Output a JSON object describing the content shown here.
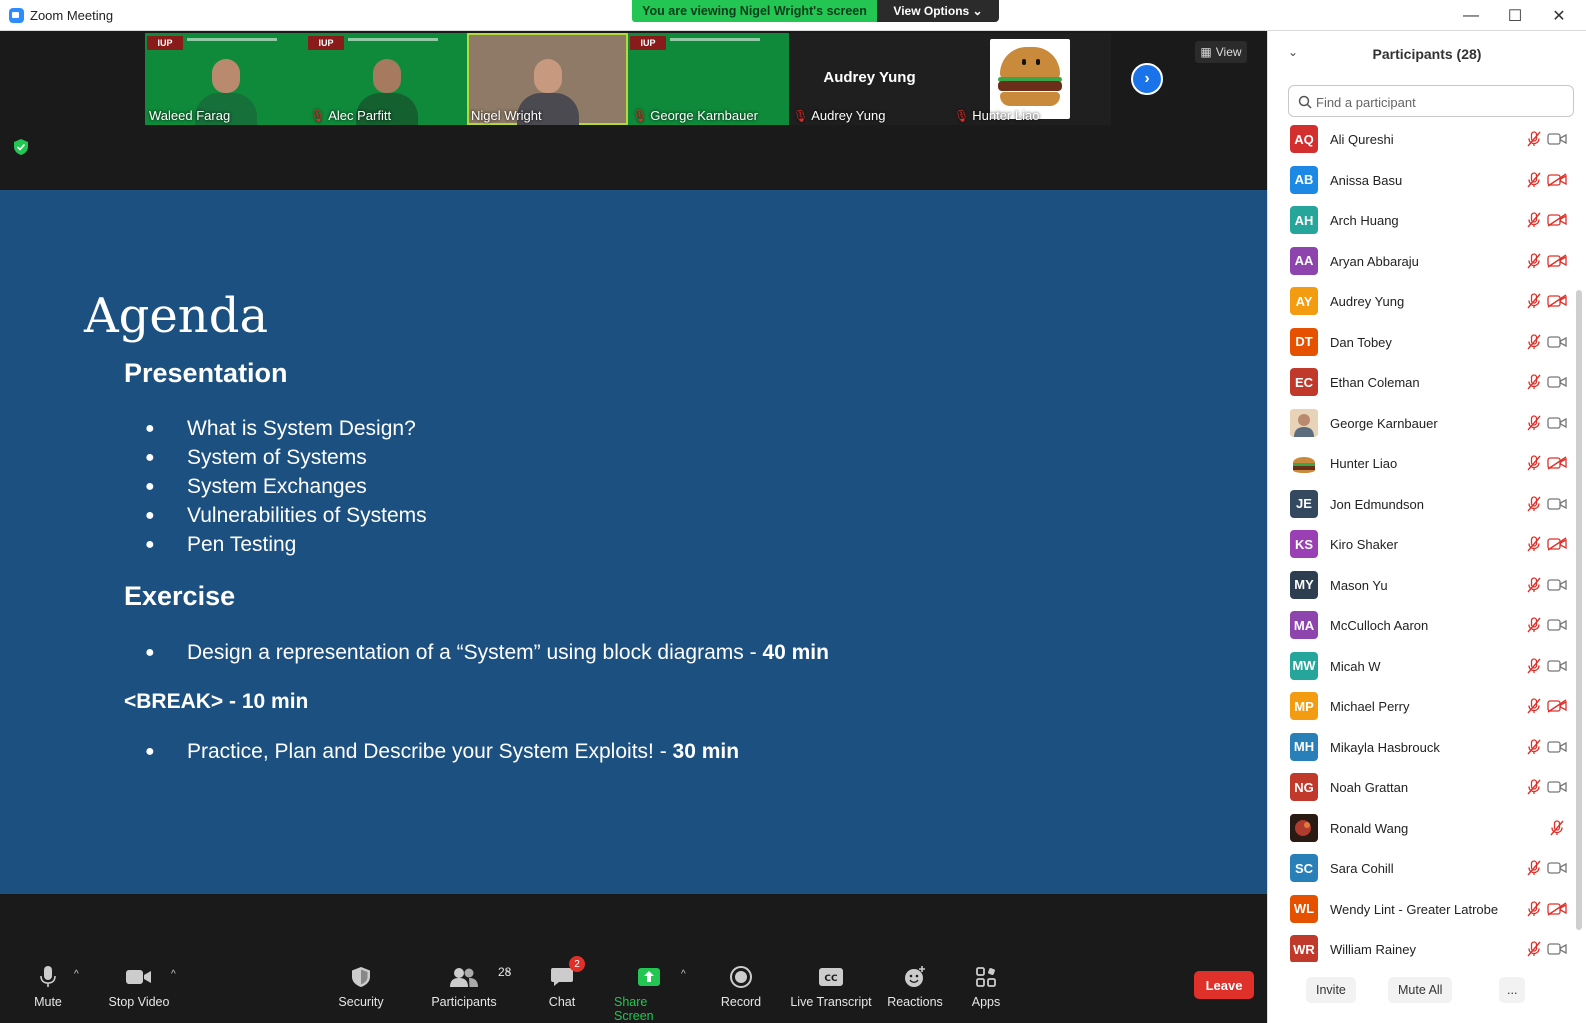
{
  "window": {
    "title": "Zoom Meeting",
    "minimize": "—",
    "maximize": "☐",
    "close": "✕"
  },
  "banner": {
    "viewing": "You are viewing Nigel Wright's screen",
    "view_options": "View Options ⌄"
  },
  "thumbnails": [
    {
      "name": "Waleed Farag",
      "muted": false,
      "badge": "IUP"
    },
    {
      "name": "Alec Parfitt",
      "muted": true,
      "badge": "IUP"
    },
    {
      "name": "Nigel Wright",
      "muted": false,
      "talking": true
    },
    {
      "name": "George Karnbauer",
      "muted": true,
      "badge": "IUP"
    },
    {
      "name": "Audrey Yung",
      "display": "Audrey Yung",
      "muted": true
    },
    {
      "name": "Hunter Liao",
      "muted": true
    }
  ],
  "view_button": "View",
  "slide": {
    "title": "Agenda",
    "section1": "Presentation",
    "items1": [
      "What is System Design?",
      "System of Systems",
      "System Exchanges",
      "Vulnerabilities of Systems",
      "Pen Testing"
    ],
    "section2": "Exercise",
    "exercise_item": "Design a representation of a “System” using block diagrams - ",
    "exercise_time": "40 min",
    "break": "<BREAK> - 10 min",
    "practice_item": "Practice, Plan and Describe your System Exploits! - ",
    "practice_time": "30 min",
    "bullet": "●"
  },
  "toolbar": {
    "mute": "Mute",
    "stop_video": "Stop Video",
    "security": "Security",
    "participants": "Participants",
    "participants_count": "28",
    "chat": "Chat",
    "chat_badge": "2",
    "share_screen": "Share Screen",
    "record": "Record",
    "live_transcript": "Live Transcript",
    "reactions": "Reactions",
    "apps": "Apps",
    "leave": "Leave",
    "caret": "^"
  },
  "panel": {
    "title": "Participants (28)",
    "search_placeholder": "Find a participant",
    "collapse": "⌄",
    "invite": "Invite",
    "mute_all": "Mute All",
    "more": "..."
  },
  "participants": [
    {
      "initials": "AQ",
      "name": "Ali Qureshi",
      "color": "#d32f2f",
      "video_off": false
    },
    {
      "initials": "AB",
      "name": "Anissa Basu",
      "color": "#1e88e5",
      "video_off": true
    },
    {
      "initials": "AH",
      "name": "Arch Huang",
      "color": "#26a69a",
      "video_off": true
    },
    {
      "initials": "AA",
      "name": "Aryan Abbaraju",
      "color": "#8e44ad",
      "video_off": true
    },
    {
      "initials": "AY",
      "name": "Audrey Yung",
      "color": "#f39c12",
      "video_off": true
    },
    {
      "initials": "DT",
      "name": "Dan Tobey",
      "color": "#e65100",
      "video_off": false
    },
    {
      "initials": "EC",
      "name": "Ethan Coleman",
      "color": "#c0392b",
      "video_off": false
    },
    {
      "initials": "",
      "name": "George Karnbauer",
      "color": "#c9a27a",
      "photo": "face",
      "video_off": false
    },
    {
      "initials": "",
      "name": "Hunter Liao",
      "color": "#c98a3c",
      "photo": "burger",
      "video_off": true
    },
    {
      "initials": "JE",
      "name": "Jon Edmundson",
      "color": "#34495e",
      "video_off": false
    },
    {
      "initials": "KS",
      "name": "Kiro Shaker",
      "color": "#9b3fb5",
      "video_off": true
    },
    {
      "initials": "MY",
      "name": "Mason Yu",
      "color": "#2c3e50",
      "video_off": false
    },
    {
      "initials": "MA",
      "name": "McCulloch Aaron",
      "color": "#8e44ad",
      "video_off": false
    },
    {
      "initials": "MW",
      "name": "Micah W",
      "color": "#26a69a",
      "video_off": false
    },
    {
      "initials": "MP",
      "name": "Michael Perry",
      "color": "#f39c12",
      "video_off": true
    },
    {
      "initials": "MH",
      "name": "Mikayla Hasbrouck",
      "color": "#2980b9",
      "video_off": false
    },
    {
      "initials": "NG",
      "name": "Noah Grattan",
      "color": "#c0392b",
      "video_off": false
    },
    {
      "initials": "",
      "name": "Ronald Wang",
      "color": "#b03a2e",
      "photo": "dark",
      "video_off": null
    },
    {
      "initials": "SC",
      "name": "Sara Cohill",
      "color": "#2980b9",
      "video_off": false
    },
    {
      "initials": "WL",
      "name": "Wendy Lint - Greater Latrobe",
      "color": "#e65100",
      "video_off": true
    },
    {
      "initials": "WR",
      "name": "William Rainey",
      "color": "#c0392b",
      "video_off": false
    }
  ],
  "colors": {
    "slide_bg": "#1c5080",
    "share_green": "#23c553",
    "leave_red": "#e0302a",
    "mute_red": "#e0302a"
  }
}
